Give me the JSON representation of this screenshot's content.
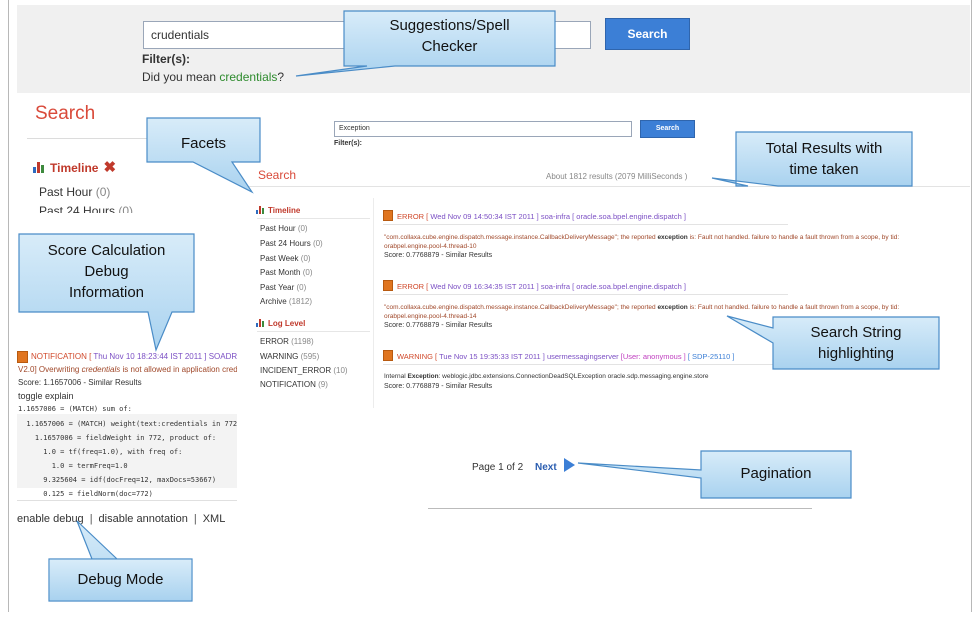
{
  "top": {
    "query": "crudentials",
    "search_button": "Search",
    "filter_label": "Filter(s):",
    "did_you_mean_prefix": "Did you mean ",
    "suggestion": "credentials",
    "did_you_mean_suffix": "?"
  },
  "left": {
    "search_title": "Search",
    "timeline_label": "Timeline",
    "close_symbol": "✖",
    "facets": [
      {
        "label": "Past Hour",
        "count": "(0)"
      },
      {
        "label": "Past 24 Hours",
        "count": "(0)"
      }
    ]
  },
  "debug": {
    "notification_head": "NOTIFICATION [",
    "notification_ts": " Thu Nov 10 18:23:44 IST 2011 ]",
    "notification_tail": " SOADRMI",
    "line1_prefix": "V2.0] Overwriting ",
    "line1_em": "credentials",
    "line1_suffix": " is not allowed in application credential s",
    "score_line": "Score: 1.1657006 - Similar Results",
    "toggle": "toggle explain",
    "explain": [
      "1.1657006 = (MATCH) sum of:",
      "  1.1657006 = (MATCH) weight(text:credentials in 772) [DefaultSimilarity], result of:",
      "    1.1657006 = fieldWeight in 772, product of:",
      "      1.0 = tf(freq=1.0), with freq of:",
      "        1.0 = termFreq=1.0",
      "      9.325604 = idf(docFreq=12, maxDocs=53667)",
      "      0.125 = fieldNorm(doc=772)"
    ],
    "links": {
      "enable": "enable debug",
      "disable_annotation": "disable annotation",
      "xml": "XML",
      "pipe": "|"
    }
  },
  "overlay": {
    "query": "Exception",
    "search_button": "Search",
    "filter_label": "Filter(s):",
    "search_title": "Search",
    "total": "About 1812 results (2079 MilliSeconds )",
    "timeline_label": "Timeline",
    "timeline": [
      {
        "label": "Past Hour",
        "count": "(0)"
      },
      {
        "label": "Past 24 Hours",
        "count": "(0)"
      },
      {
        "label": "Past Week",
        "count": "(0)"
      },
      {
        "label": "Past Month",
        "count": "(0)"
      },
      {
        "label": "Past Year",
        "count": "(0)"
      },
      {
        "label": "Archive",
        "count": "(1812)"
      }
    ],
    "loglevel_label": "Log Level",
    "loglevel": [
      {
        "label": "ERROR",
        "count": "(1198)"
      },
      {
        "label": "WARNING",
        "count": "(595)"
      },
      {
        "label": "INCIDENT_ERROR",
        "count": "(10)"
      },
      {
        "label": "NOTIFICATION",
        "count": "(9)"
      }
    ],
    "results": [
      {
        "severity": "ERROR [",
        "ts": " Wed Nov 09 14:50:34 IST 2011 ]",
        "server": " soa-infra [",
        "cls": " oracle.soa.bpel.engine.dispatch ]",
        "msg1_pre": "\"com.collaxa.cube.engine.dispatch.message.instance.CallbackDeliveryMessage\"; the reported ",
        "msg1_hl": "exception",
        "msg1_post": " is: Fault not handled. failure to handle a fault thrown from a scope, by tid:",
        "msg2": "orabpel.engine.pool-4.thread-10",
        "score": "Score: 0.7768879  -  Similar Results"
      },
      {
        "severity": "ERROR [",
        "ts": " Wed Nov 09 16:34:35 IST 2011 ]",
        "server": " soa-infra [",
        "cls": " oracle.soa.bpel.engine.dispatch ]",
        "msg1_pre": "\"com.collaxa.cube.engine.dispatch.message.instance.CallbackDeliveryMessage\"; the reported ",
        "msg1_hl": "exception",
        "msg1_post": " is: Fault not handled. failure to handle a fault thrown from a scope, by tid:",
        "msg2": "orabpel.engine.pool-4.thread-14",
        "score": "Score: 0.7768879  -  Similar Results"
      },
      {
        "severity": "WARNING [",
        "ts": " Tue Nov 15 19:35:33 IST 2011 ]",
        "server": " usermessagingserver ",
        "user": "[User: anonymous ]",
        "sdp": " [ SDP-25110 ]",
        "msg1_pre": "Internal ",
        "msg1_hl": "Exception",
        "msg1_post": ": weblogic.jdbc.extensions.ConnectionDeadSQLException oracle.sdp.messaging.engine.store",
        "score": "Score: 0.7768879  -  Similar Results"
      }
    ],
    "pagination": {
      "info": "Page 1 of 2",
      "next": "Next"
    }
  },
  "callouts": {
    "suggestions": [
      "Suggestions/Spell",
      "Checker"
    ],
    "facets": [
      "Facets"
    ],
    "total": [
      "Total Results with",
      "time taken"
    ],
    "score": [
      "Score Calculation",
      "Debug",
      "Information"
    ],
    "highlight": [
      "Search String",
      "highlighting"
    ],
    "pagination": [
      "Pagination"
    ],
    "debug_mode": [
      "Debug Mode"
    ]
  },
  "colors": {
    "accent": "#3c7fd6",
    "callout_fill": "#b9dcf2",
    "callout_stroke": "#4a8cc7",
    "error": "#d0482a"
  }
}
